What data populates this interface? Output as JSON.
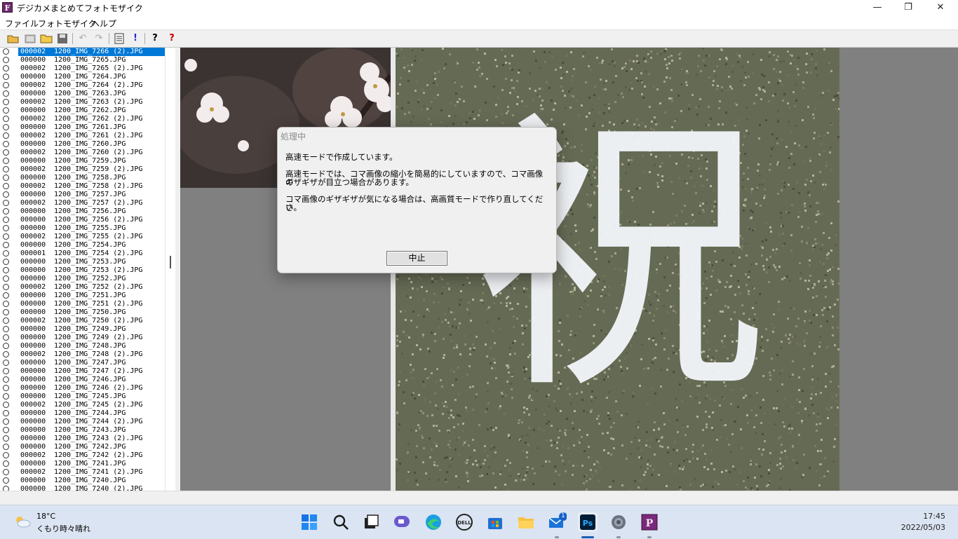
{
  "window": {
    "title": "デジカメまとめてフォトモザイク",
    "app_icon_letter": "F",
    "minimize": "—",
    "maximize": "❐",
    "close": "✕"
  },
  "menu": [
    "ファイル",
    "フォトモザイク",
    "ヘルプ"
  ],
  "toolbar": {
    "icons": [
      "open-folder-icon",
      "open-image-icon",
      "folder-icon",
      "save-icon",
      "undo-icon",
      "redo-icon",
      "list-icon",
      "exclamation-icon",
      "help-icon",
      "context-help-icon"
    ]
  },
  "file_list": [
    {
      "count": "000002",
      "name": "1200_IMG_7266 (2).JPG",
      "selected": true
    },
    {
      "count": "000000",
      "name": "1200_IMG_7265.JPG"
    },
    {
      "count": "000002",
      "name": "1200_IMG_7265 (2).JPG"
    },
    {
      "count": "000000",
      "name": "1200_IMG_7264.JPG"
    },
    {
      "count": "000002",
      "name": "1200_IMG_7264 (2).JPG"
    },
    {
      "count": "000000",
      "name": "1200_IMG_7263.JPG"
    },
    {
      "count": "000002",
      "name": "1200_IMG_7263 (2).JPG"
    },
    {
      "count": "000000",
      "name": "1200_IMG_7262.JPG"
    },
    {
      "count": "000002",
      "name": "1200_IMG_7262 (2).JPG"
    },
    {
      "count": "000000",
      "name": "1200_IMG_7261.JPG"
    },
    {
      "count": "000002",
      "name": "1200_IMG_7261 (2).JPG"
    },
    {
      "count": "000000",
      "name": "1200_IMG_7260.JPG"
    },
    {
      "count": "000002",
      "name": "1200_IMG_7260 (2).JPG"
    },
    {
      "count": "000000",
      "name": "1200_IMG_7259.JPG"
    },
    {
      "count": "000002",
      "name": "1200_IMG_7259 (2).JPG"
    },
    {
      "count": "000000",
      "name": "1200_IMG_7258.JPG"
    },
    {
      "count": "000002",
      "name": "1200_IMG_7258 (2).JPG"
    },
    {
      "count": "000000",
      "name": "1200_IMG_7257.JPG"
    },
    {
      "count": "000002",
      "name": "1200_IMG_7257 (2).JPG"
    },
    {
      "count": "000000",
      "name": "1200_IMG_7256.JPG"
    },
    {
      "count": "000000",
      "name": "1200_IMG_7256 (2).JPG"
    },
    {
      "count": "000000",
      "name": "1200_IMG_7255.JPG"
    },
    {
      "count": "000002",
      "name": "1200_IMG_7255 (2).JPG"
    },
    {
      "count": "000000",
      "name": "1200_IMG_7254.JPG"
    },
    {
      "count": "000001",
      "name": "1200_IMG_7254 (2).JPG"
    },
    {
      "count": "000000",
      "name": "1200_IMG_7253.JPG"
    },
    {
      "count": "000000",
      "name": "1200_IMG_7253 (2).JPG"
    },
    {
      "count": "000000",
      "name": "1200_IMG_7252.JPG"
    },
    {
      "count": "000002",
      "name": "1200_IMG_7252 (2).JPG"
    },
    {
      "count": "000000",
      "name": "1200_IMG_7251.JPG"
    },
    {
      "count": "000000",
      "name": "1200_IMG_7251 (2).JPG"
    },
    {
      "count": "000000",
      "name": "1200_IMG_7250.JPG"
    },
    {
      "count": "000002",
      "name": "1200_IMG_7250 (2).JPG"
    },
    {
      "count": "000000",
      "name": "1200_IMG_7249.JPG"
    },
    {
      "count": "000000",
      "name": "1200_IMG_7249 (2).JPG"
    },
    {
      "count": "000000",
      "name": "1200_IMG_7248.JPG"
    },
    {
      "count": "000002",
      "name": "1200_IMG_7248 (2).JPG"
    },
    {
      "count": "000000",
      "name": "1200_IMG_7247.JPG"
    },
    {
      "count": "000000",
      "name": "1200_IMG_7247 (2).JPG"
    },
    {
      "count": "000000",
      "name": "1200_IMG_7246.JPG"
    },
    {
      "count": "000000",
      "name": "1200_IMG_7246 (2).JPG"
    },
    {
      "count": "000000",
      "name": "1200_IMG_7245.JPG"
    },
    {
      "count": "000002",
      "name": "1200_IMG_7245 (2).JPG"
    },
    {
      "count": "000000",
      "name": "1200_IMG_7244.JPG"
    },
    {
      "count": "000000",
      "name": "1200_IMG_7244 (2).JPG"
    },
    {
      "count": "000000",
      "name": "1200_IMG_7243.JPG"
    },
    {
      "count": "000000",
      "name": "1200_IMG_7243 (2).JPG"
    },
    {
      "count": "000000",
      "name": "1200_IMG_7242.JPG"
    },
    {
      "count": "000002",
      "name": "1200_IMG_7242 (2).JPG"
    },
    {
      "count": "000000",
      "name": "1200_IMG_7241.JPG"
    },
    {
      "count": "000002",
      "name": "1200_IMG_7241 (2).JPG"
    },
    {
      "count": "000000",
      "name": "1200_IMG_7240.JPG"
    },
    {
      "count": "000000",
      "name": "1200_IMG_7240 (2).JPG"
    }
  ],
  "mosaic": {
    "character": "祝",
    "background_color": "#656a55"
  },
  "dialog": {
    "title": "処理中",
    "line1": "高速モードで作成しています。",
    "line2a": "高速モードでは、コマ画像の縮小を簡易的にしていますので、コマ画像の",
    "line2b": "ギザギザが目立つ場合があります。",
    "line3a": "コマ画像のギザギザが気になる場合は、高画質モードで作り直してくださ",
    "line3b": "い。",
    "cancel_button": "中止"
  },
  "taskbar": {
    "weather_temp": "18°C",
    "weather_condition": "くもり時々晴れ",
    "mail_badge": "1",
    "time": "17:45",
    "date": "2022/05/03",
    "apps": [
      "start-icon",
      "search-icon",
      "task-view-icon",
      "chat-icon",
      "edge-icon",
      "dell-icon",
      "store-icon",
      "file-explorer-icon",
      "mail-icon",
      "photoshop-icon",
      "settings-icon",
      "photomosaic-app-icon"
    ]
  }
}
